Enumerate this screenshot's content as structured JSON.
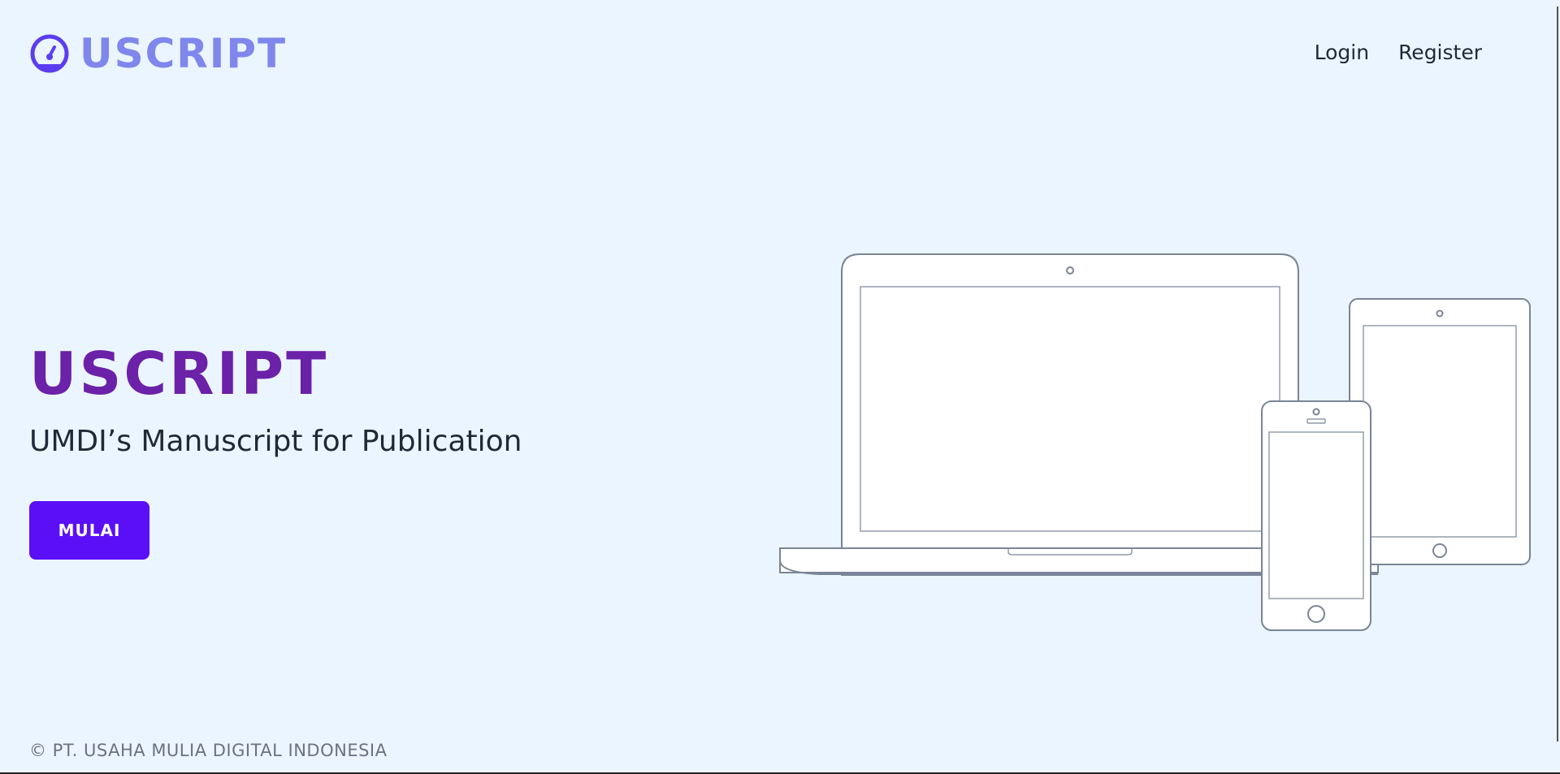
{
  "brand": {
    "name": "USCRIPT",
    "icon": "speedometer-icon"
  },
  "nav": {
    "login": "Login",
    "register": "Register"
  },
  "hero": {
    "title": "USCRIPT",
    "subtitle": "UMDI’s Manuscript for Publication",
    "cta": "MULAI",
    "illustration": "devices-illustration"
  },
  "footer": {
    "copyright": "© PT. USAHA MULIA DIGITAL INDONESIA"
  },
  "colors": {
    "background": "#ebf5ff",
    "brand_text": "#7f87ec",
    "brand_icon": "#5b3df0",
    "hero_title": "#6b21a8",
    "cta_background": "#5b0ff7",
    "device_stroke": "#7a8597"
  }
}
